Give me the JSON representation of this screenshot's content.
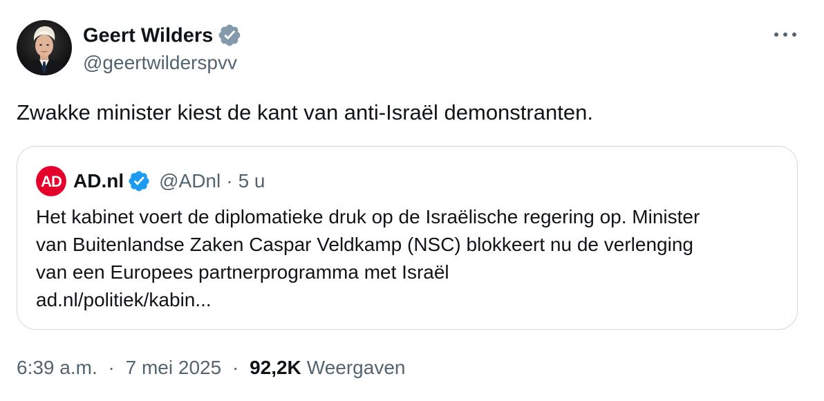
{
  "author": {
    "display_name": "Geert Wilders",
    "handle": "@geertwilderspvv",
    "verified": true,
    "verified_color": "#829aab",
    "avatar_icon": "profile-photo"
  },
  "menu": {
    "more_icon": "ellipsis-horizontal-icon"
  },
  "tweet": {
    "text": "Zwakke minister kiest de kant van anti-Israël demonstranten."
  },
  "quoted_tweet": {
    "logo_text": "AD",
    "logo_color": "#e4002b",
    "display_name": "AD.nl",
    "verified": true,
    "verified_color": "#1d9bf0",
    "handle": "@ADnl",
    "separator": "·",
    "time": "5 u",
    "lines": [
      "Het kabinet voert de diplomatieke druk op de Israëlische regering op. Minister",
      "van Buitenlandse Zaken Caspar Veldkamp (NSC) blokkeert nu de verlenging",
      "van een Europees partnerprogramma met Israël",
      "ad.nl/politiek/kabin..."
    ]
  },
  "meta": {
    "time": "6:39 a.m.",
    "separator": "·",
    "date": "7 mei 2025",
    "views_count": "92,2K",
    "views_label": "Weergaven"
  },
  "colors": {
    "text_primary": "#0f1419",
    "text_secondary": "#536471",
    "border": "#cfd9de"
  }
}
